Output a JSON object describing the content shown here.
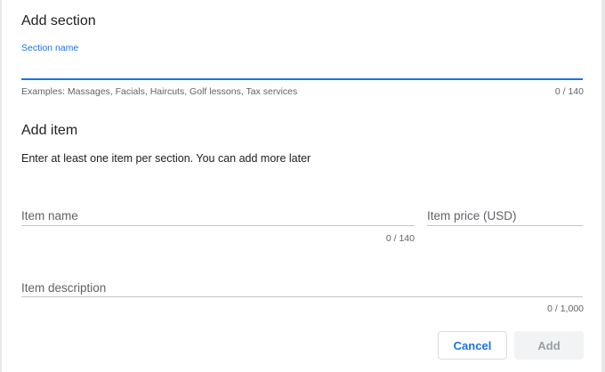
{
  "section": {
    "title": "Add section",
    "name_label": "Section name",
    "name_value": "",
    "hint": "Examples: Massages, Facials, Haircuts, Golf lessons, Tax services",
    "counter": "0 / 140"
  },
  "item": {
    "title": "Add item",
    "instructions": "Enter at least one item per section. You can add more later",
    "name_label": "Item name",
    "name_counter": "0 / 140",
    "price_label": "Item price (USD)",
    "description_label": "Item description",
    "description_counter": "0 / 1,000"
  },
  "actions": {
    "cancel_label": "Cancel",
    "add_label": "Add"
  },
  "colors": {
    "accent": "#1a73e8",
    "disabled_text": "#9aa0a6"
  }
}
